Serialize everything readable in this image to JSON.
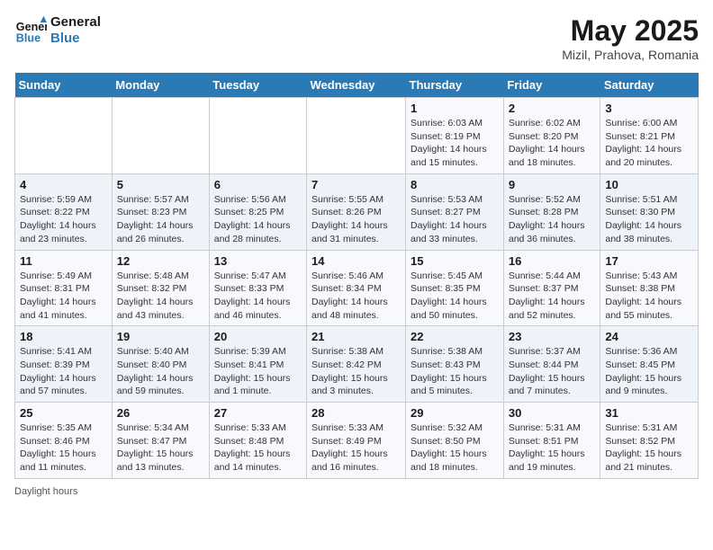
{
  "header": {
    "logo_general": "General",
    "logo_blue": "Blue",
    "month_year": "May 2025",
    "location": "Mizil, Prahova, Romania"
  },
  "weekdays": [
    "Sunday",
    "Monday",
    "Tuesday",
    "Wednesday",
    "Thursday",
    "Friday",
    "Saturday"
  ],
  "weeks": [
    [
      {
        "day": "",
        "info": ""
      },
      {
        "day": "",
        "info": ""
      },
      {
        "day": "",
        "info": ""
      },
      {
        "day": "",
        "info": ""
      },
      {
        "day": "1",
        "info": "Sunrise: 6:03 AM\nSunset: 8:19 PM\nDaylight: 14 hours and 15 minutes."
      },
      {
        "day": "2",
        "info": "Sunrise: 6:02 AM\nSunset: 8:20 PM\nDaylight: 14 hours and 18 minutes."
      },
      {
        "day": "3",
        "info": "Sunrise: 6:00 AM\nSunset: 8:21 PM\nDaylight: 14 hours and 20 minutes."
      }
    ],
    [
      {
        "day": "4",
        "info": "Sunrise: 5:59 AM\nSunset: 8:22 PM\nDaylight: 14 hours and 23 minutes."
      },
      {
        "day": "5",
        "info": "Sunrise: 5:57 AM\nSunset: 8:23 PM\nDaylight: 14 hours and 26 minutes."
      },
      {
        "day": "6",
        "info": "Sunrise: 5:56 AM\nSunset: 8:25 PM\nDaylight: 14 hours and 28 minutes."
      },
      {
        "day": "7",
        "info": "Sunrise: 5:55 AM\nSunset: 8:26 PM\nDaylight: 14 hours and 31 minutes."
      },
      {
        "day": "8",
        "info": "Sunrise: 5:53 AM\nSunset: 8:27 PM\nDaylight: 14 hours and 33 minutes."
      },
      {
        "day": "9",
        "info": "Sunrise: 5:52 AM\nSunset: 8:28 PM\nDaylight: 14 hours and 36 minutes."
      },
      {
        "day": "10",
        "info": "Sunrise: 5:51 AM\nSunset: 8:30 PM\nDaylight: 14 hours and 38 minutes."
      }
    ],
    [
      {
        "day": "11",
        "info": "Sunrise: 5:49 AM\nSunset: 8:31 PM\nDaylight: 14 hours and 41 minutes."
      },
      {
        "day": "12",
        "info": "Sunrise: 5:48 AM\nSunset: 8:32 PM\nDaylight: 14 hours and 43 minutes."
      },
      {
        "day": "13",
        "info": "Sunrise: 5:47 AM\nSunset: 8:33 PM\nDaylight: 14 hours and 46 minutes."
      },
      {
        "day": "14",
        "info": "Sunrise: 5:46 AM\nSunset: 8:34 PM\nDaylight: 14 hours and 48 minutes."
      },
      {
        "day": "15",
        "info": "Sunrise: 5:45 AM\nSunset: 8:35 PM\nDaylight: 14 hours and 50 minutes."
      },
      {
        "day": "16",
        "info": "Sunrise: 5:44 AM\nSunset: 8:37 PM\nDaylight: 14 hours and 52 minutes."
      },
      {
        "day": "17",
        "info": "Sunrise: 5:43 AM\nSunset: 8:38 PM\nDaylight: 14 hours and 55 minutes."
      }
    ],
    [
      {
        "day": "18",
        "info": "Sunrise: 5:41 AM\nSunset: 8:39 PM\nDaylight: 14 hours and 57 minutes."
      },
      {
        "day": "19",
        "info": "Sunrise: 5:40 AM\nSunset: 8:40 PM\nDaylight: 14 hours and 59 minutes."
      },
      {
        "day": "20",
        "info": "Sunrise: 5:39 AM\nSunset: 8:41 PM\nDaylight: 15 hours and 1 minute."
      },
      {
        "day": "21",
        "info": "Sunrise: 5:38 AM\nSunset: 8:42 PM\nDaylight: 15 hours and 3 minutes."
      },
      {
        "day": "22",
        "info": "Sunrise: 5:38 AM\nSunset: 8:43 PM\nDaylight: 15 hours and 5 minutes."
      },
      {
        "day": "23",
        "info": "Sunrise: 5:37 AM\nSunset: 8:44 PM\nDaylight: 15 hours and 7 minutes."
      },
      {
        "day": "24",
        "info": "Sunrise: 5:36 AM\nSunset: 8:45 PM\nDaylight: 15 hours and 9 minutes."
      }
    ],
    [
      {
        "day": "25",
        "info": "Sunrise: 5:35 AM\nSunset: 8:46 PM\nDaylight: 15 hours and 11 minutes."
      },
      {
        "day": "26",
        "info": "Sunrise: 5:34 AM\nSunset: 8:47 PM\nDaylight: 15 hours and 13 minutes."
      },
      {
        "day": "27",
        "info": "Sunrise: 5:33 AM\nSunset: 8:48 PM\nDaylight: 15 hours and 14 minutes."
      },
      {
        "day": "28",
        "info": "Sunrise: 5:33 AM\nSunset: 8:49 PM\nDaylight: 15 hours and 16 minutes."
      },
      {
        "day": "29",
        "info": "Sunrise: 5:32 AM\nSunset: 8:50 PM\nDaylight: 15 hours and 18 minutes."
      },
      {
        "day": "30",
        "info": "Sunrise: 5:31 AM\nSunset: 8:51 PM\nDaylight: 15 hours and 19 minutes."
      },
      {
        "day": "31",
        "info": "Sunrise: 5:31 AM\nSunset: 8:52 PM\nDaylight: 15 hours and 21 minutes."
      }
    ]
  ],
  "footer": {
    "daylight_label": "Daylight hours"
  }
}
